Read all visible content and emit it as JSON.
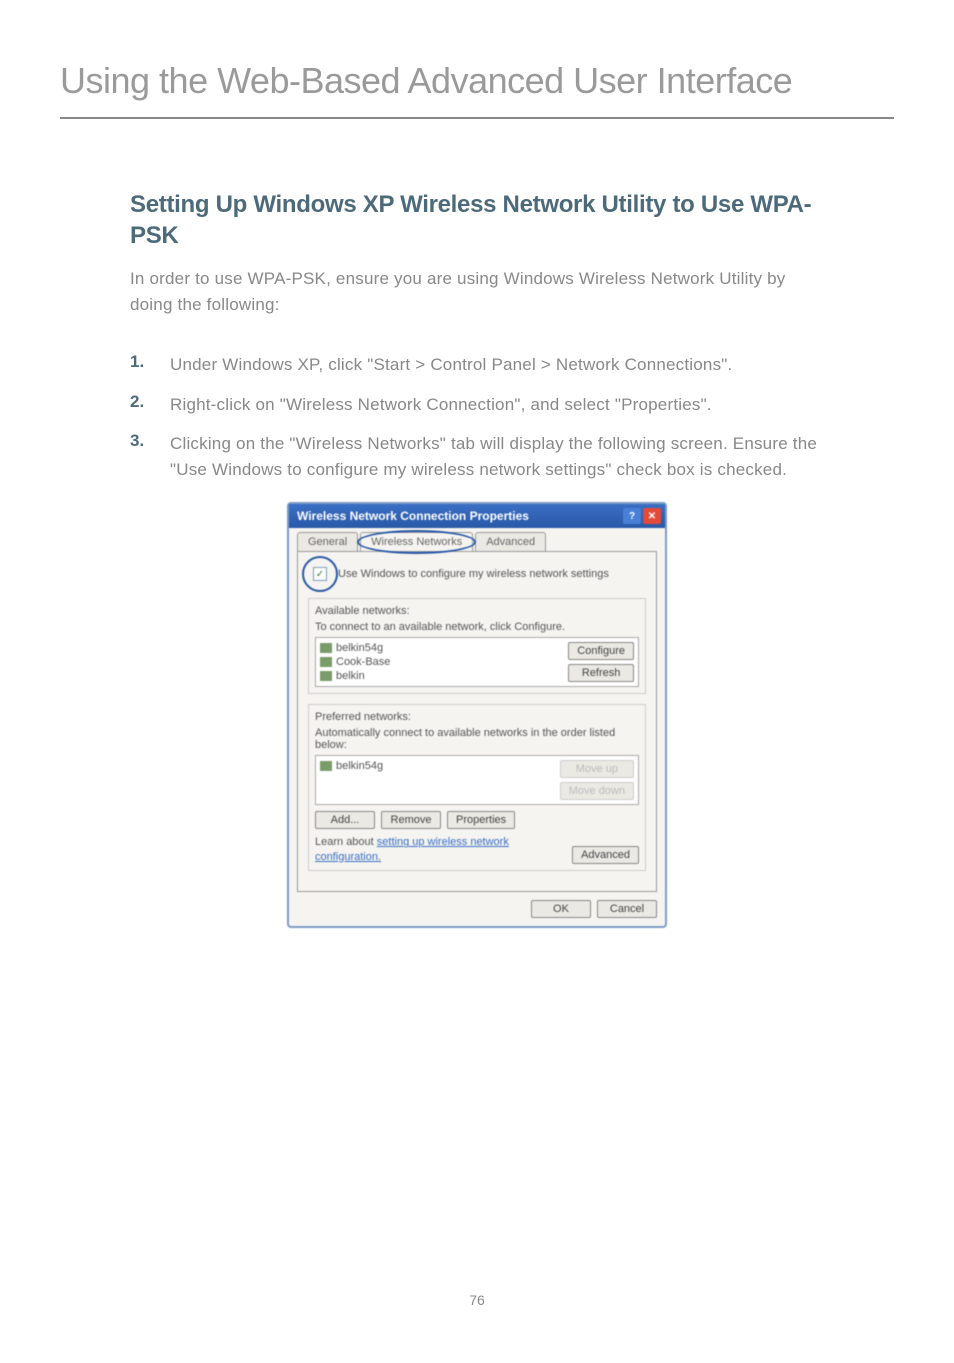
{
  "page": {
    "header": "Using the Web-Based Advanced User Interface",
    "number": "76"
  },
  "section": {
    "heading": "Setting Up Windows XP Wireless Network Utility to Use WPA-PSK",
    "intro": "In order to use WPA-PSK, ensure you are using Windows Wireless Network Utility by doing the following:"
  },
  "steps": [
    {
      "num": "1.",
      "text": "Under Windows XP, click \"Start > Control Panel > Network Connections\"."
    },
    {
      "num": "2.",
      "text": "Right-click on \"Wireless Network Connection\", and select \"Properties\"."
    },
    {
      "num": "3.",
      "text": "Clicking on the \"Wireless Networks\" tab will display the following screen. Ensure the \"Use Windows to configure my wireless network settings\" check box is checked."
    }
  ],
  "dialog": {
    "title": "Wireless Network Connection Properties",
    "tabs": {
      "general": "General",
      "wireless": "Wireless Networks",
      "advanced": "Advanced"
    },
    "checkbox_label": "Use Windows to configure my wireless network settings",
    "available": {
      "label": "Available networks:",
      "hint": "To connect to an available network, click Configure.",
      "items": [
        "belkin54g",
        "Cook-Base",
        "belkin"
      ],
      "configure": "Configure",
      "refresh": "Refresh"
    },
    "preferred": {
      "label": "Preferred networks:",
      "hint": "Automatically connect to available networks in the order listed below:",
      "items": [
        "belkin54g"
      ],
      "moveup": "Move up",
      "movedown": "Move down",
      "add": "Add...",
      "remove": "Remove",
      "properties": "Properties"
    },
    "learn": "Learn about setting up wireless network configuration.",
    "advanced_btn": "Advanced",
    "ok": "OK",
    "cancel": "Cancel"
  }
}
